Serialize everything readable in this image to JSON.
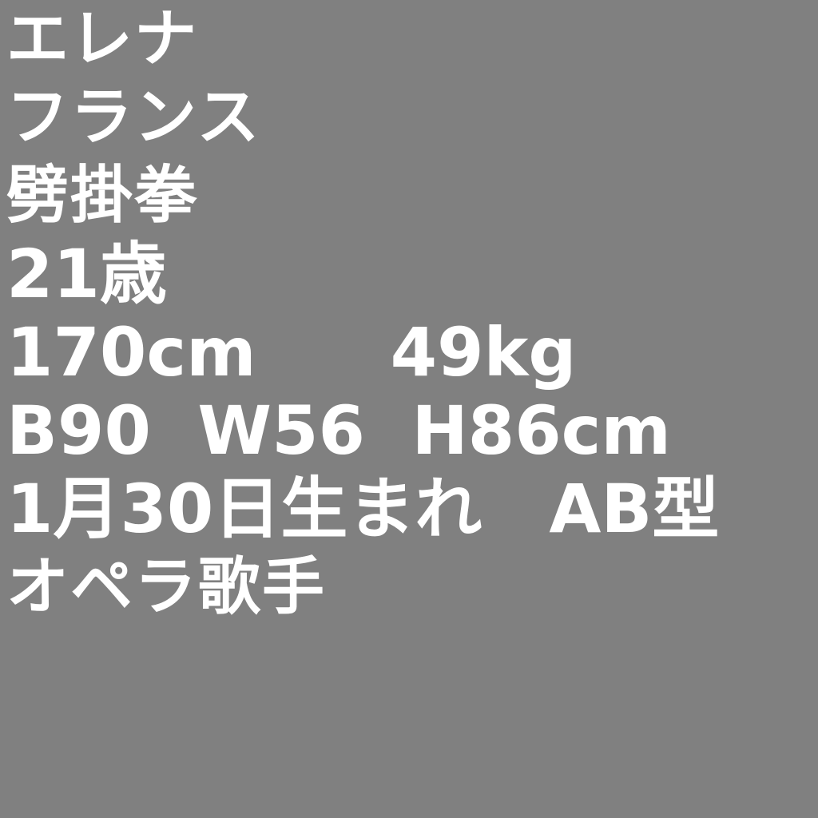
{
  "profile": {
    "name": "エレナ",
    "country": "フランス",
    "fighting_style": "劈掛拳",
    "age": "21歳",
    "height_weight": "170cm　　49kg",
    "measurements": "B90  W56  H86cm",
    "birthday_blood": "1月30日生まれ　AB型",
    "occupation": "オペラ歌手"
  },
  "colors": {
    "background": "#808080",
    "text": "#ffffff"
  }
}
